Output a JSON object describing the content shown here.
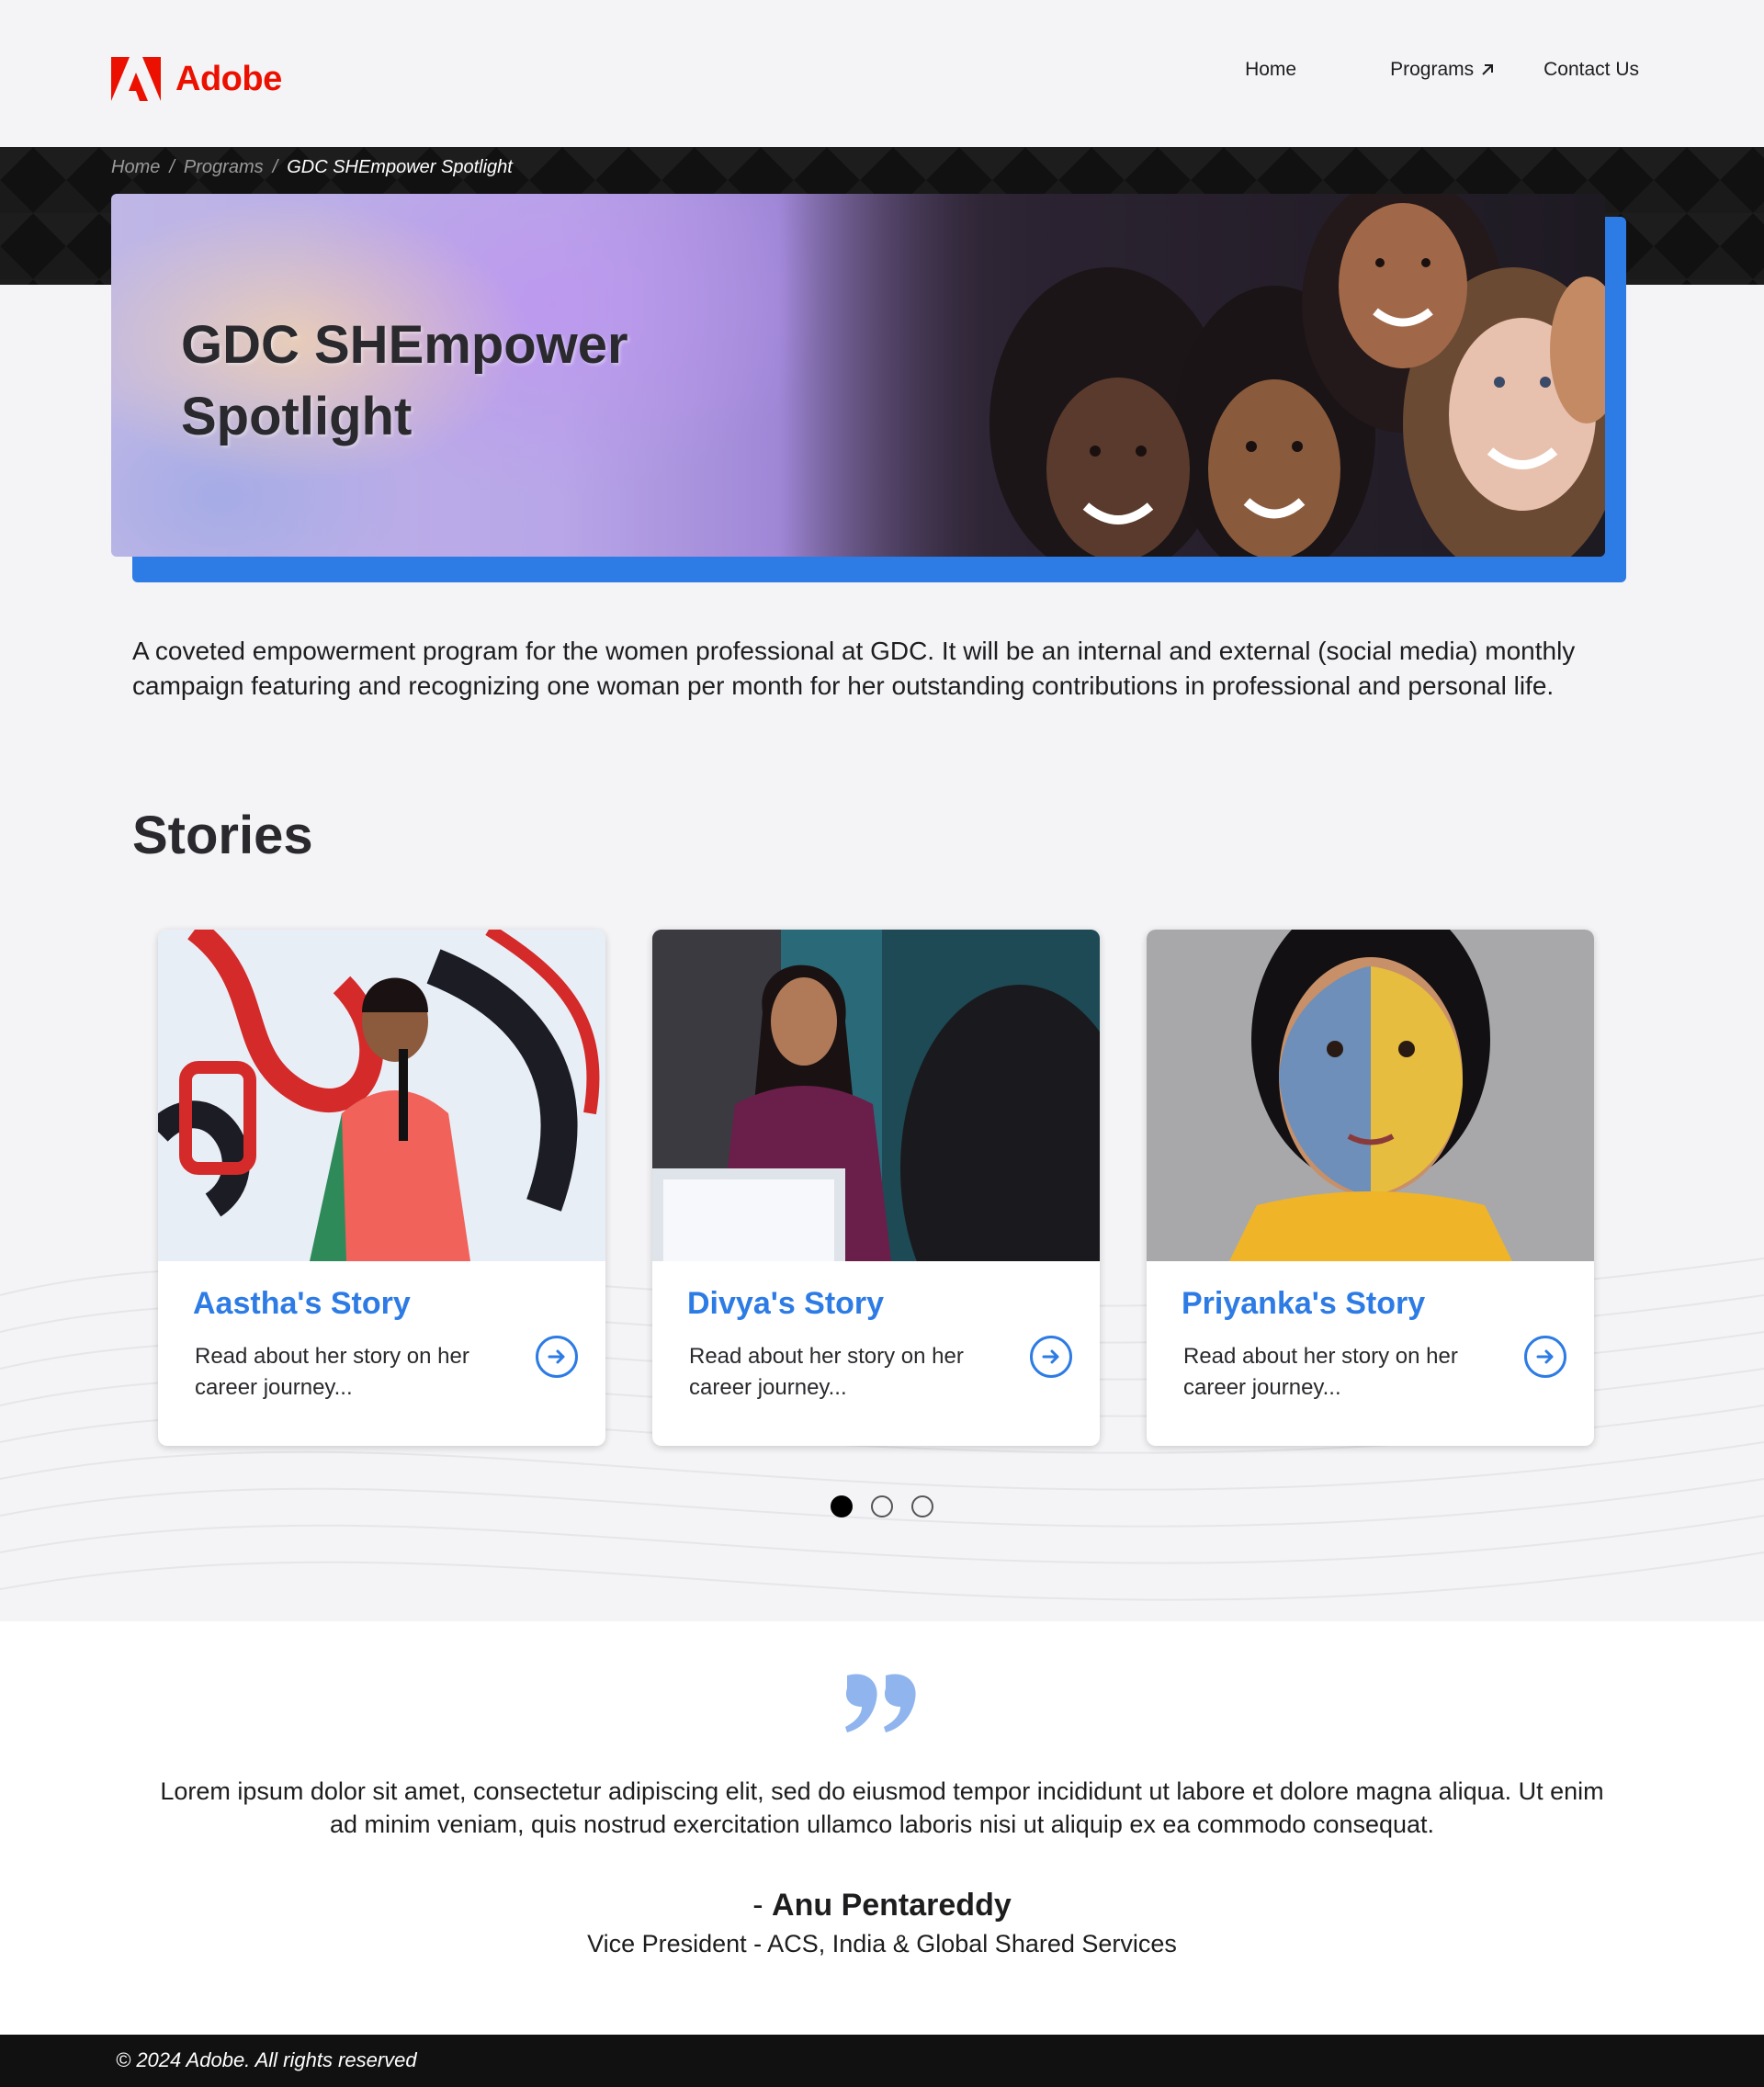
{
  "brand": {
    "name": "Adobe",
    "color": "#eb1000",
    "logo_icon": "adobe-logo-icon"
  },
  "nav": {
    "home": "Home",
    "programs": "Programs",
    "programs_icon": "external-arrow-icon",
    "contact": "Contact Us"
  },
  "breadcrumb": [
    {
      "label": "Home"
    },
    {
      "label": "Programs"
    },
    {
      "label": "GDC SHEmpower Spotlight"
    }
  ],
  "breadcrumb_separator": "/",
  "hero": {
    "title": "GDC SHEmpower Spotlight"
  },
  "intro": "A coveted empowerment program for the women professional at GDC. It will be an internal and external (social media) monthly campaign featuring and recognizing one woman per month for her outstanding contributions in professional and personal life.",
  "stories": {
    "heading": "Stories",
    "cards": [
      {
        "title": "Aastha's Story",
        "text": "Read about her story on her career journey..."
      },
      {
        "title": "Divya's Story",
        "text": "Read about her story on her career journey..."
      },
      {
        "title": "Priyanka's Story",
        "text": "Read about her story on her career journey..."
      }
    ],
    "active_page": 1,
    "page_count": 3
  },
  "quote": {
    "text": "Lorem ipsum dolor sit amet, consectetur adipiscing elit, sed do eiusmod tempor incididunt ut labore et dolore magna aliqua. Ut enim ad minim veniam, quis nostrud exercitation ullamco laboris nisi ut aliquip ex ea commodo consequat.",
    "author_prefix": "- ",
    "author": "Anu Pentareddy",
    "role": "Vice President - ACS, India & Global Shared Services"
  },
  "footer": {
    "copyright": "© 2024 Adobe. All rights reserved"
  },
  "colors": {
    "accent": "#2d7be5",
    "brand": "#eb1000",
    "footer_bg": "#111111"
  }
}
